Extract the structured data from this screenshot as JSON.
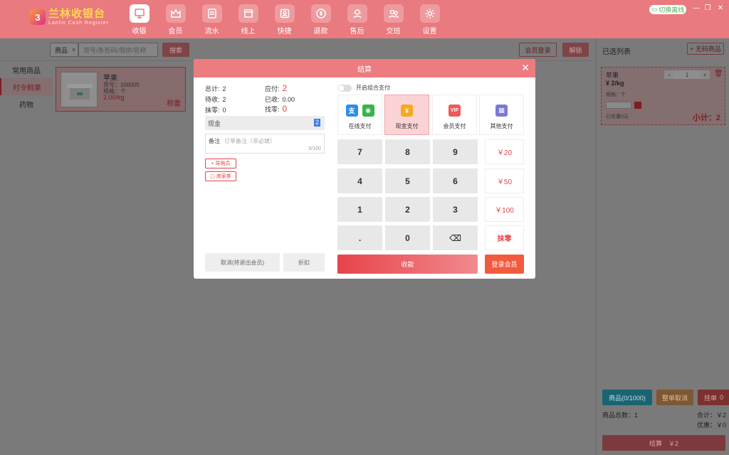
{
  "app": {
    "logo_mark": "3",
    "logo_title": "兰林收银台",
    "logo_sub": "Lanlin Cash Register"
  },
  "nav": [
    {
      "label": "收银",
      "icon": "cashier-icon",
      "active": true
    },
    {
      "label": "会员",
      "icon": "crown-icon"
    },
    {
      "label": "流水",
      "icon": "ledger-icon"
    },
    {
      "label": "线上",
      "icon": "store-icon"
    },
    {
      "label": "快捷",
      "icon": "shortcut-icon"
    },
    {
      "label": "退款",
      "icon": "refund-icon"
    },
    {
      "label": "售后",
      "icon": "aftersale-icon"
    },
    {
      "label": "交班",
      "icon": "shift-icon"
    },
    {
      "label": "设置",
      "icon": "gear-icon"
    }
  ],
  "header": {
    "switch_offline": "切换离线",
    "min": "—",
    "restore": "❐",
    "close": "✕"
  },
  "search": {
    "category_select": "商品",
    "placeholder": "货号/条形码/简拼/名称",
    "search_btn": "搜索",
    "member_login_btn": "会员登录",
    "unlock_btn": "解锁"
  },
  "categories": [
    {
      "label": "常用商品"
    },
    {
      "label": "时令鲜果",
      "active": true
    },
    {
      "label": "药物"
    }
  ],
  "product": {
    "name": "苹果",
    "code": "货号：100005",
    "spec": "规格：个",
    "price": "2.00/kg",
    "tag": "称重"
  },
  "right": {
    "title": "已选列表",
    "add_btn": "+ 无码商品",
    "item": {
      "name": "苹果",
      "qty": "1",
      "price": "¥ 2/kg",
      "spec": "规格：个",
      "discount_note": "已优惠0元",
      "subtotal": "小计：2"
    },
    "buttons": {
      "goods": "商品(0/1000)",
      "cancel_order": "整单取消",
      "hang": "挂单",
      "hang_count": "0"
    },
    "total_qty_label": "商品总数：1",
    "total_label": "合计：￥2",
    "discount_label": "优惠：￥0",
    "checkout_btn": "结算　￥2"
  },
  "modal": {
    "title": "结算",
    "close": "✕",
    "stats": {
      "total_label": "总计:",
      "total": "2",
      "payable_label": "应付:",
      "payable": "2",
      "pending_label": "待收:",
      "pending": "2",
      "received_label": "已收:",
      "received": "0.00",
      "rounding_label": "抹零:",
      "rounding": "0",
      "change_label": "找零:",
      "change": "0"
    },
    "cash_label": "现金",
    "cash_value": "2",
    "remark_label": "备注",
    "remark_placeholder": "订单备注（非必填）",
    "remark_count": "0/100",
    "guide_btn": "+ 导购员",
    "coupon_btn": "商家券",
    "cancel_btn": "取消(将退出会员)",
    "discount_btn": "折扣",
    "combo_toggle": "开启组合支付",
    "pay_methods": [
      {
        "label": "在线支付"
      },
      {
        "label": "现金支付",
        "active": true
      },
      {
        "label": "会员支付"
      },
      {
        "label": "其他支付"
      }
    ],
    "keys": [
      "7",
      "8",
      "9",
      "4",
      "5",
      "6",
      "1",
      "2",
      "3",
      ".",
      "0",
      "⌫"
    ],
    "quick": [
      "￥20",
      "￥50",
      "￥100",
      "抹零"
    ],
    "collect_btn": "收款",
    "login_member_btn": "登录会员"
  },
  "colors": {
    "accent": "#e97a7f",
    "red": "#e8434a",
    "orange": "#f25a3f"
  }
}
